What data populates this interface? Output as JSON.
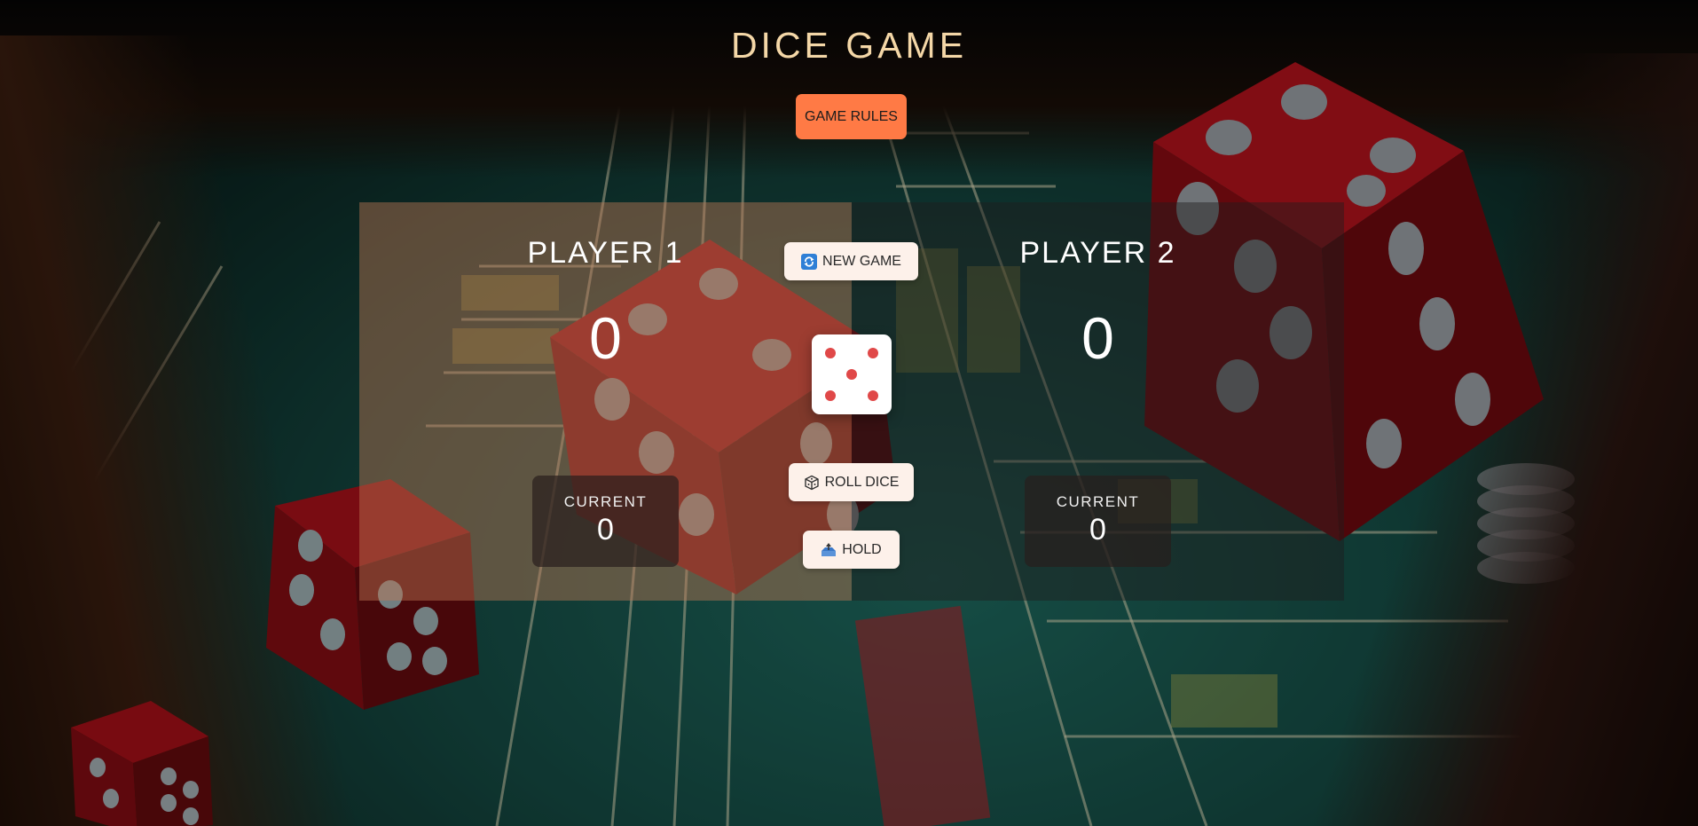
{
  "app": {
    "title": "DICE GAME",
    "rules_label": "GAME RULES"
  },
  "players": [
    {
      "name": "PLAYER 1",
      "score": "0",
      "current_label": "CURRENT",
      "current_score": "0",
      "active": true
    },
    {
      "name": "PLAYER 2",
      "score": "0",
      "current_label": "CURRENT",
      "current_score": "0",
      "active": false
    }
  ],
  "controls": {
    "new_game_label": "NEW GAME",
    "new_game_icon": "refresh-icon",
    "roll_label": "ROLL DICE",
    "roll_icon": "dice-cube-icon",
    "hold_label": "HOLD",
    "hold_icon": "inbox-tray-icon"
  },
  "dice": {
    "face": 5
  },
  "colors": {
    "title": "#f4d7a7",
    "rules_button": "#ff7a45",
    "active_panel": "#be7855",
    "pip": "#e04848",
    "control_button": "#fdf1ea"
  }
}
